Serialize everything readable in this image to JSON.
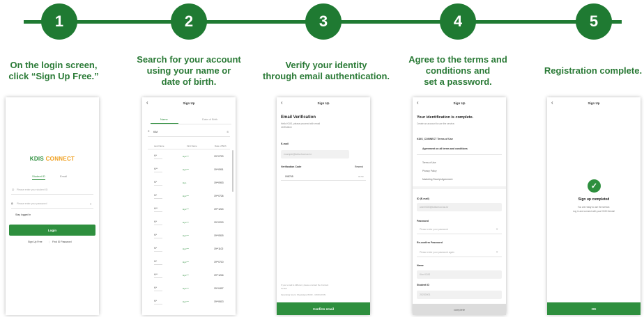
{
  "steps": [
    {
      "number": "1",
      "caption": "On the login screen,\nclick “Sign Up Free.”"
    },
    {
      "number": "2",
      "caption": "Search for your account\nusing your name or\ndate of birth."
    },
    {
      "number": "3",
      "caption": "Verify your identity\nthrough email authentication."
    },
    {
      "number": "4",
      "caption": "Agree to the terms and\nconditions and\nset a password."
    },
    {
      "number": "5",
      "caption": "Registration complete."
    }
  ],
  "screen1": {
    "logo_text": "KDIS CONNECT",
    "tab_student": "Student ID",
    "tab_email": "Email",
    "id_placeholder": "Please enter your student ID",
    "pw_placeholder": "Please enter your password",
    "stay_logged_in": "Stay logged in",
    "login_button": "Login",
    "sign_up_link": "Sign Up Free",
    "find_password_link": "Find ID Password"
  },
  "screen2": {
    "title": "Sign Up",
    "tab_name": "Name",
    "tab_dob": "Date of Birth",
    "search_value": "KIM",
    "col_last": "Last Name",
    "col_first": "First Name",
    "col_dob": "Date of Birth",
    "rows": [
      {
        "last": "Ki*",
        "first": "Hyo***",
        "dob": "19**0720"
      },
      {
        "last": "Ki**",
        "first": "Hyo***",
        "dob": "19**0901"
      },
      {
        "last": "Ki*",
        "first": "Hyo",
        "dob": "19**0903"
      },
      {
        "last": "Ki*",
        "first": "Hyo***",
        "dob": "19**0726"
      },
      {
        "last": "Ki**",
        "first": "Hyo***",
        "dob": "19**1224"
      },
      {
        "last": "Ki*",
        "first": "Hyo***",
        "dob": "19**0219"
      },
      {
        "last": "Ki*",
        "first": "Hyo***",
        "dob": "19**0515"
      },
      {
        "last": "Ki*",
        "first": "Hyo***",
        "dob": "19**1102"
      },
      {
        "last": "Ki*",
        "first": "Hyo***",
        "dob": "19**0710"
      },
      {
        "last": "Ki**",
        "first": "Hyo***",
        "dob": "19**1216"
      },
      {
        "last": "Ki*",
        "first": "Hyo***",
        "dob": "19**0407"
      },
      {
        "last": "Ki*",
        "first": "Hyo***",
        "dob": "19**0613"
      }
    ]
  },
  "screen3": {
    "title": "Sign Up",
    "heading": "Email Verification",
    "subtext": "Hello KDIS, please proceed with email verification",
    "email_label": "E-mail",
    "email_value": "example@kdischool.ac.kr",
    "code_label": "Verification Code",
    "resend": "Resend",
    "code_value": "098765",
    "timer": "04:59",
    "footer_text": "If your email is different, please contact the Contact Center",
    "footer_hours": "Operating hours: Weekdays 09:00 - 18:00 (KST)",
    "confirm_button": "Confirm email"
  },
  "screen4": {
    "title": "Sign Up",
    "heading": "Your identification is complete.",
    "subtext": "Create an account to use the service.",
    "terms_label": "KDIS_CONNECT Terms of Use",
    "agree_all": "Agreement on all terms and conditions",
    "terms": [
      "Terms of Use",
      "Privacy Policy",
      "Marketing Receipt Agreement"
    ],
    "id_label": "ID (E-mail)",
    "id_value": "user0000@kdischool.ac.kr",
    "pw_label": "Password",
    "pw_placeholder": "Please enter your password",
    "confirm_label": "Re-confirm Password",
    "confirm_placeholder": "Please enter your password again",
    "name_label": "Name",
    "name_value": "Kim KDIS",
    "student_id_label": "Student ID",
    "student_id_value": "20230001",
    "complete_button": "complete"
  },
  "screen5": {
    "title": "Sign Up",
    "heading": "Sign up completed",
    "line1": "You are ready to use the service.",
    "line2": "Log in and connect with your KDIS friends!",
    "ok_button": "OK"
  },
  "colors": {
    "primary": "#1f7a32",
    "button": "#2e8f3e",
    "caption": "#2a7a36",
    "logo_kdis": "#2e8f3e",
    "logo_connect": "#f0a020"
  }
}
